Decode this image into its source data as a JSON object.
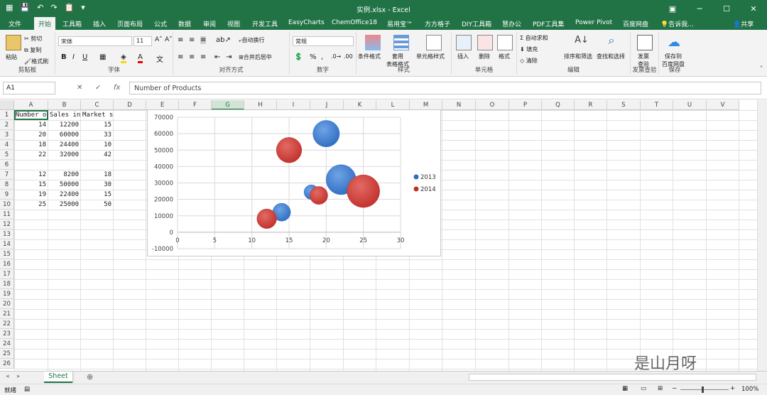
{
  "window": {
    "title": "实例.xlsx - Excel"
  },
  "tabs": [
    "文件",
    "开始",
    "工具箱",
    "插入",
    "页面布局",
    "公式",
    "数据",
    "审阅",
    "视图",
    "开发工具",
    "EasyCharts",
    "ChemOffice18",
    "易用宝™",
    "方方格子",
    "DIY工具箱",
    "慧办公",
    "PDF工具集",
    "Power Pivot",
    "百度网盘"
  ],
  "tell_me": "告诉我...",
  "share": "共享",
  "ribbon": {
    "clipboard": {
      "label": "剪贴板",
      "paste": "粘贴",
      "cut": "剪切",
      "copy": "复制",
      "format_painter": "格式刷"
    },
    "font": {
      "label": "字体",
      "name": "宋体",
      "size": "11"
    },
    "alignment": {
      "label": "对齐方式",
      "wrap": "自动换行",
      "merge": "合并后居中"
    },
    "number": {
      "label": "数字",
      "format": "常规"
    },
    "styles": {
      "label": "样式",
      "conditional": "条件格式",
      "table": "套用\n表格格式",
      "cell": "单元格样式"
    },
    "cells": {
      "label": "单元格",
      "insert": "插入",
      "delete": "删除",
      "format": "格式"
    },
    "editing": {
      "label": "编辑",
      "autosum": "自动求和",
      "fill": "填充",
      "clear": "清除",
      "sort": "排序和筛选",
      "find": "查找和选择"
    },
    "check": {
      "label": "发票查验",
      "btn": "发票\n查验"
    },
    "save": {
      "label": "保存",
      "btn": "保存到\n百度网盘"
    }
  },
  "formula_bar": {
    "name_box": "A1",
    "content": "Number of Products"
  },
  "columns": [
    "A",
    "B",
    "C",
    "D",
    "E",
    "F",
    "G",
    "H",
    "I",
    "J",
    "K",
    "L",
    "M",
    "N",
    "O",
    "P",
    "Q",
    "R",
    "S",
    "T",
    "U",
    "V"
  ],
  "rows": [
    "1",
    "2",
    "3",
    "4",
    "5",
    "6",
    "7",
    "8",
    "9",
    "10",
    "11",
    "12",
    "13",
    "14",
    "15",
    "16",
    "17",
    "18",
    "19",
    "20",
    "21",
    "22",
    "23",
    "24",
    "25",
    "26"
  ],
  "cells": {
    "A1": "Number of Products",
    "B1": "Sales in ",
    "C1": "Market share",
    "A2": "14",
    "B2": "12200",
    "C2": "15",
    "A3": "20",
    "B3": "60000",
    "C3": "33",
    "A4": "18",
    "B4": "24400",
    "C4": "10",
    "A5": "22",
    "B5": "32000",
    "C5": "42",
    "A7": "12",
    "B7": "8200",
    "C7": "18",
    "A8": "15",
    "B8": "50000",
    "C8": "30",
    "A9": "19",
    "B9": "22400",
    "C9": "15",
    "A10": "25",
    "B10": "25000",
    "C10": "50"
  },
  "chart_data": {
    "type": "scatter",
    "subtype": "bubble",
    "xlim": [
      0,
      30
    ],
    "ylim": [
      -10000,
      70000
    ],
    "x_ticks": [
      "0",
      "5",
      "10",
      "15",
      "20",
      "25",
      "30"
    ],
    "y_ticks": [
      "-10000",
      "0",
      "10000",
      "20000",
      "30000",
      "40000",
      "50000",
      "60000",
      "70000"
    ],
    "grid": true,
    "legend": "right",
    "series": [
      {
        "name": "2013",
        "color": "#2e6dc0",
        "x": [
          14,
          20,
          18,
          22
        ],
        "y": [
          12200,
          60000,
          24400,
          32000
        ],
        "size": [
          15,
          33,
          10,
          42
        ]
      },
      {
        "name": "2014",
        "color": "#c0302b",
        "x": [
          12,
          15,
          19,
          25
        ],
        "y": [
          8200,
          50000,
          22400,
          25000
        ],
        "size": [
          18,
          30,
          15,
          50
        ]
      }
    ]
  },
  "sheet_tab": "Sheet",
  "status": {
    "left": "就绪",
    "zoom": "100%"
  },
  "watermark": "是山月呀",
  "colors": {
    "excel_green": "#217346"
  }
}
